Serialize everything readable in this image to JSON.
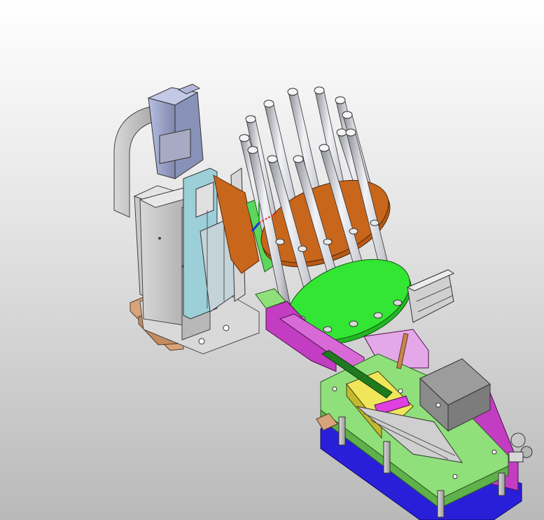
{
  "viewport": {
    "background_top": "#ffffff",
    "background_bottom": "#b8b8b8"
  },
  "colors": {
    "steel_light": "#d4d6dc",
    "steel_mid": "#a9acb6",
    "steel_dark": "#7d808a",
    "frame_gray": "#bdbdbd",
    "motor_blue_gray": "#9aa3c8",
    "orange_plate": "#c8661c",
    "green_plate": "#33e633",
    "light_green": "#8fe07a",
    "magenta": "#c23dc2",
    "blue_base": "#2a1fd8",
    "yellow_block": "#e0d63a",
    "tan_bracket": "#d7a37a"
  },
  "icons": {
    "triad": "axis-triad-icon"
  }
}
